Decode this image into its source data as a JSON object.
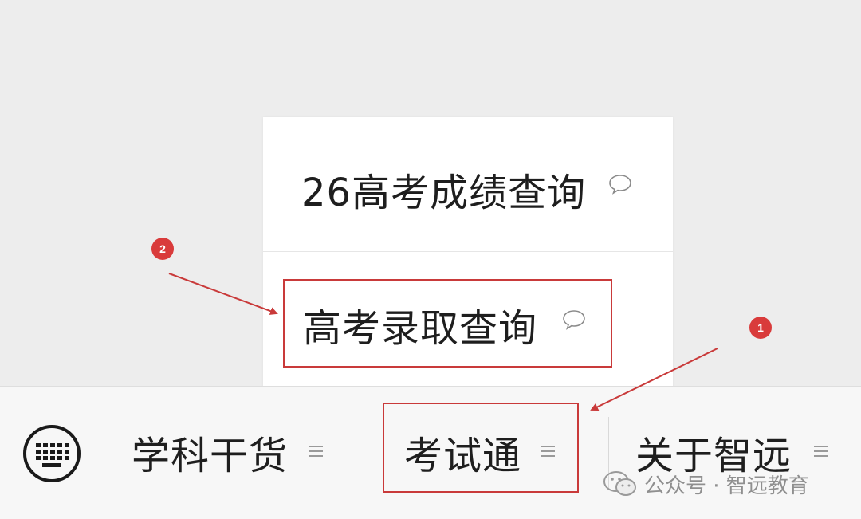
{
  "popup": {
    "items": [
      {
        "label": "26高考成绩查询",
        "icon": "chat-bubble-icon"
      },
      {
        "label": "高考录取查询",
        "icon": "chat-bubble-icon"
      }
    ]
  },
  "menubar": {
    "keyboard_icon": "keyboard-icon",
    "items": [
      {
        "label": "学科干货",
        "icon": "submenu-lines-icon"
      },
      {
        "label": "考试通",
        "icon": "submenu-lines-icon"
      },
      {
        "label": "关于智远",
        "icon": "submenu-lines-icon"
      }
    ]
  },
  "annotations": {
    "badge_1": "1",
    "badge_2": "2",
    "color": "#d93b3b"
  },
  "watermark": {
    "text": "公众号 · 智远教育",
    "icon": "wechat-logo-icon"
  }
}
